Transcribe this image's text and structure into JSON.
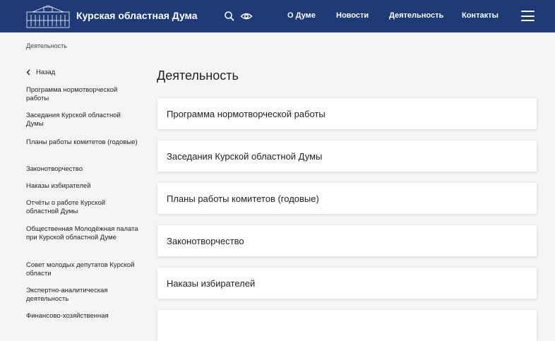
{
  "header": {
    "site_title": "Курская областная Дума",
    "nav": [
      "О Думе",
      "Новости",
      "Деятельность",
      "Контакты"
    ],
    "bg_color": "#1e3b78",
    "icons": [
      "building-logo-icon",
      "search-icon",
      "eye-icon",
      "hamburger-menu-icon"
    ]
  },
  "breadcrumb": "Деятельность",
  "sidebar": {
    "back_label": "Назад",
    "items": [
      "Программа нормотворческой работы",
      "Заседания Курской областной Думы",
      "Планы работы комитетов (годовые)",
      "Законотворчество",
      "Наказы избирателей",
      "Отчёты о работе Курской областной Думы",
      "Общественная Молодёжная палата при Курской областной Думе",
      "Совет молодых депутатов Курской области",
      "Экспертно-аналитическая деятельность",
      "Финансово-хозяйственная"
    ]
  },
  "main": {
    "title": "Деятельность",
    "cards": [
      "Программа нормотворческой работы",
      "Заседания Курской областной Думы",
      "Планы работы комитетов (годовые)",
      "Законотворчество",
      "Наказы избирателей",
      ""
    ]
  }
}
